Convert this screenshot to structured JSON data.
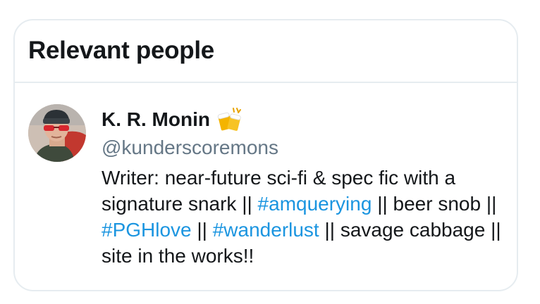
{
  "card": {
    "title": "Relevant people"
  },
  "person": {
    "name": "K. R. Monin",
    "handle": "@kunderscoremons",
    "name_emoji_icon": "clinking-beer-mugs-icon",
    "bio": {
      "text_1": "Writer: near-future sci-fi & spec fic with a signature snark || ",
      "hashtag_1": "#amquerying",
      "text_2": " || beer snob || ",
      "hashtag_2": "#PGHlove",
      "text_3": " || ",
      "hashtag_3": "#wanderlust",
      "text_4": " || savage cabbage || site in the works!!"
    }
  },
  "colors": {
    "link": "#1b95e0",
    "secondary_text": "#657786",
    "border": "#e6ecf0"
  }
}
